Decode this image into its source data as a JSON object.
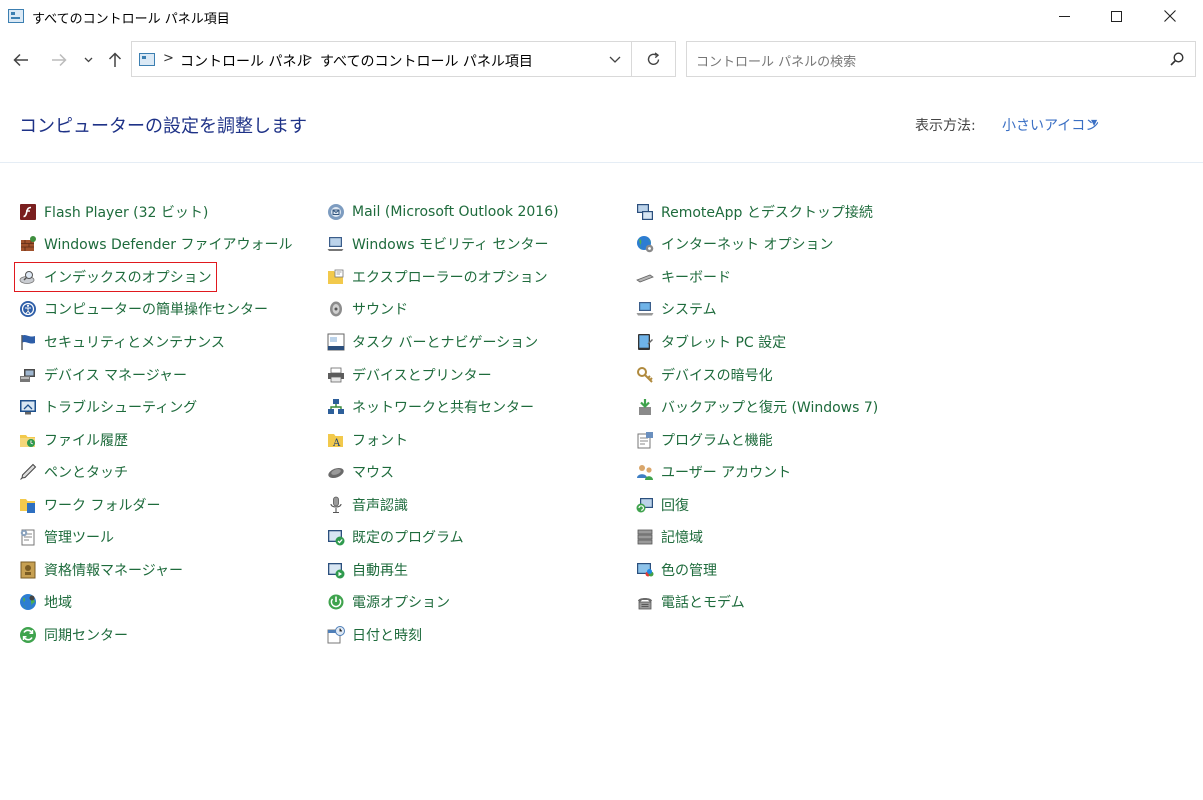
{
  "window": {
    "title": "すべてのコントロール パネル項目"
  },
  "address": {
    "crumbs": [
      "コントロール パネル",
      "すべてのコントロール パネル項目"
    ],
    "separator": ">"
  },
  "search": {
    "placeholder": "コントロール パネルの検索"
  },
  "header": {
    "title": "コンピューターの設定を調整します",
    "view_label": "表示方法:",
    "view_value": "小さいアイコン"
  },
  "items": {
    "flash_player": "Flash Player (32 ビット)",
    "windows_defender": "Windows Defender ファイアウォール",
    "indexing": "インデックスのオプション",
    "ease_of_access": "コンピューターの簡単操作センター",
    "security_maintenance": "セキュリティとメンテナンス",
    "device_manager": "デバイス マネージャー",
    "troubleshooting": "トラブルシューティング",
    "file_history": "ファイル履歴",
    "pen_touch": "ペンとタッチ",
    "work_folders": "ワーク フォルダー",
    "admin_tools": "管理ツール",
    "credential_manager": "資格情報マネージャー",
    "region": "地域",
    "sync_center": "同期センター",
    "mail": "Mail (Microsoft Outlook 2016)",
    "mobility_center": "Windows モビリティ センター",
    "explorer_options": "エクスプローラーのオプション",
    "sound": "サウンド",
    "taskbar_nav": "タスク バーとナビゲーション",
    "devices_printers": "デバイスとプリンター",
    "network_sharing": "ネットワークと共有センター",
    "fonts": "フォント",
    "mouse": "マウス",
    "speech": "音声認識",
    "default_programs": "既定のプログラム",
    "autoplay": "自動再生",
    "power_options": "電源オプション",
    "date_time": "日付と時刻",
    "remoteapp": "RemoteApp とデスクトップ接続",
    "internet_options": "インターネット オプション",
    "keyboard": "キーボード",
    "system": "システム",
    "tablet_pc": "タブレット PC 設定",
    "device_encryption": "デバイスの暗号化",
    "backup_restore": "バックアップと復元 (Windows 7)",
    "programs_features": "プログラムと機能",
    "user_accounts": "ユーザー アカウント",
    "recovery": "回復",
    "storage_spaces": "記憶域",
    "color_management": "色の管理",
    "phone_modem": "電話とモデム"
  },
  "colors": {
    "link_green": "#1e6b3c",
    "heading_blue": "#1e3287",
    "accent_blue": "#3a6fc4",
    "highlight_red": "#e0191e"
  }
}
